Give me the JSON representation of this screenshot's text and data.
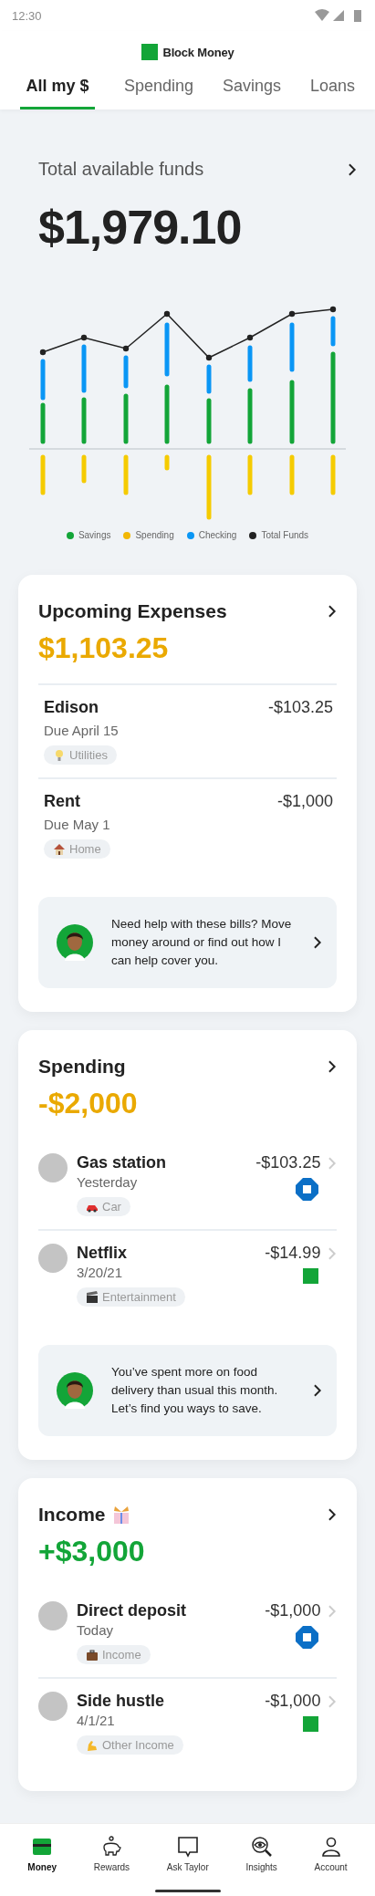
{
  "status_bar": {
    "time": "12:30"
  },
  "app": {
    "name": "Block Money"
  },
  "tabs": [
    {
      "label": "All my $",
      "selected": true
    },
    {
      "label": "Spending",
      "selected": false
    },
    {
      "label": "Savings",
      "selected": false
    },
    {
      "label": "Loans",
      "selected": false
    }
  ],
  "funds": {
    "title": "Total available funds",
    "amount": "$1,979.10",
    "legend": [
      {
        "label": "Savings",
        "color": "#13a538"
      },
      {
        "label": "Spending",
        "color": "#f2b705"
      },
      {
        "label": "Checking",
        "color": "#0a96f5"
      },
      {
        "label": "Total Funds",
        "color": "#222222"
      }
    ]
  },
  "sections": [
    {
      "kind": "bills",
      "title": "Upcoming Expenses",
      "amount": "$1,103.25",
      "items": [
        {
          "name": "Edison",
          "date": "Due April 15",
          "amount": "-$103.25",
          "tag": {
            "label": "Utilities",
            "kind": "bulb"
          }
        },
        {
          "name": "Rent",
          "date": "Due May 1",
          "amount": "-$1,000",
          "tag": {
            "label": "Home",
            "kind": "house"
          }
        }
      ],
      "tip": "Need help with these bills? Move money around or find out how I can help cover you."
    },
    {
      "kind": "spending",
      "title": "Spending",
      "amount": "-$2,000",
      "items": [
        {
          "name": "Gas station",
          "date": "Yesterday",
          "amount": "-$103.25",
          "kind": "octagon",
          "tag": {
            "label": "Car",
            "kind": "car"
          }
        },
        {
          "name": "Netflix",
          "date": "3/20/21",
          "amount": "-$14.99",
          "kind": "square",
          "tag": {
            "label": "Entertainment",
            "kind": "clapper"
          }
        }
      ],
      "tip": "You’ve spent more on food delivery than usual this month. Let’s find you ways to save."
    },
    {
      "kind": "income",
      "title": "Income",
      "amount": "+$3,000",
      "items": [
        {
          "name": "Direct deposit",
          "date": "Today",
          "amount": "-$1,000",
          "kind": "octagon",
          "tag": {
            "label": "Income",
            "kind": "briefcase"
          }
        },
        {
          "name": "Side hustle",
          "date": "4/1/21",
          "amount": "-$1,000",
          "kind": "square",
          "tag": {
            "label": "Other Income",
            "kind": "arm"
          }
        }
      ]
    }
  ],
  "nav": [
    {
      "label": "Money",
      "kind": "card",
      "selected": true
    },
    {
      "label": "Rewards",
      "kind": "piggy",
      "selected": false
    },
    {
      "label": "Ask Taylor",
      "kind": "chat",
      "selected": false
    },
    {
      "label": "Insights",
      "kind": "eye",
      "selected": false
    },
    {
      "label": "Account",
      "kind": "person",
      "selected": false
    }
  ]
}
